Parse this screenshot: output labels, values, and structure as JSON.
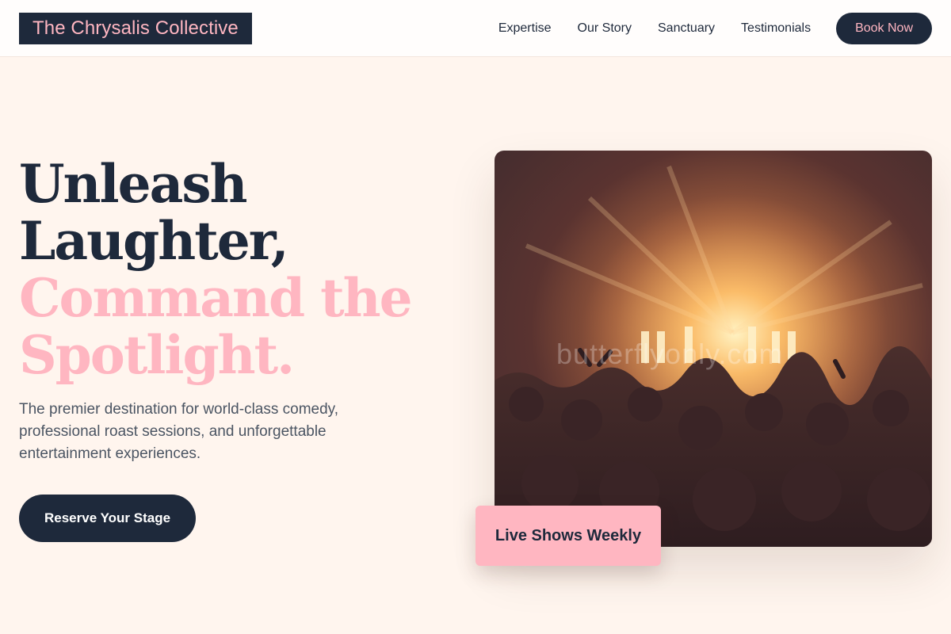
{
  "header": {
    "brand": "The Chrysalis Collective",
    "nav": [
      "Expertise",
      "Our Story",
      "Sanctuary",
      "Testimonials"
    ],
    "book_label": "Book Now"
  },
  "hero": {
    "headline_line1": "Unleash",
    "headline_line2": "Laughter,",
    "headline_line3": "Command the",
    "headline_line4": "Spotlight.",
    "subtext": "The premier destination for world-class comedy, professional roast sessions, and unforgettable entertainment experiences.",
    "cta_label": "Reserve Your Stage",
    "badge_label": "Live Shows Weekly",
    "watermark": "butterflyonly.com"
  },
  "colors": {
    "navy": "#1e293b",
    "pink": "#ffb6c1",
    "background": "#fff5ee"
  }
}
